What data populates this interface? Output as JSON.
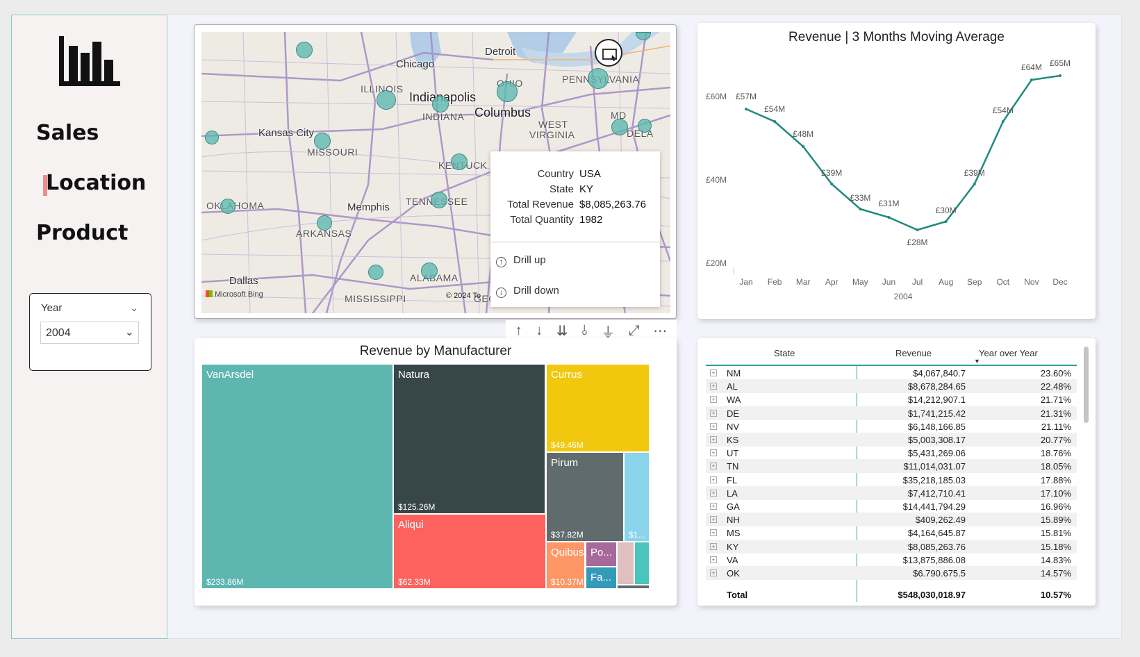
{
  "nav": {
    "sales": "Sales",
    "location": "Location",
    "product": "Product"
  },
  "slicer": {
    "label": "Year",
    "value": "2004"
  },
  "map": {
    "cities": [
      "Detroit",
      "Chicago",
      "Indianapolis",
      "Columbus",
      "Kansas City",
      "Memphis",
      "Dallas"
    ],
    "states": [
      "ILLINOIS",
      "INDIANA",
      "OHIO",
      "PENNSYLVANIA",
      "MISSOURI",
      "WEST",
      "VIRGINIA",
      "MD",
      "DELA",
      "KENTUCK",
      "TENNESSEE",
      "OKLAHOMA",
      "ARKANSAS",
      "ALABAMA",
      "MISSISSIPPI",
      "GEORGIA"
    ],
    "attribution": "Microsoft Bing",
    "copyright": "© 2024 To",
    "tooltip": {
      "country_label": "Country",
      "country": "USA",
      "state_label": "State",
      "state": "KY",
      "revenue_label": "Total Revenue",
      "revenue": "$8,085,263.76",
      "quantity_label": "Total Quantity",
      "quantity": "1982",
      "drill_up": "Drill up",
      "drill_down": "Drill down"
    }
  },
  "line_chart": {
    "title": "Revenue | 3 Months Moving Average",
    "x_axis_title": "2004",
    "color": "#1f8a80"
  },
  "chart_data": {
    "type": "line",
    "title": "Revenue | 3 Months Moving Average",
    "xlabel": "2004",
    "ylabel": "",
    "categories": [
      "Jan",
      "Feb",
      "Mar",
      "Apr",
      "May",
      "Jun",
      "Jul",
      "Aug",
      "Sep",
      "Oct",
      "Nov",
      "Dec"
    ],
    "values": [
      57,
      54,
      48,
      39,
      33,
      31,
      28,
      30,
      39,
      54,
      64,
      65
    ],
    "data_labels": [
      "£57M",
      "£54M",
      "£48M",
      "£39M",
      "£33M",
      "£31M",
      "£28M",
      "£30M",
      "£39M",
      "£54M",
      "£64M",
      "£65M"
    ],
    "y_ticks": [
      "£20M",
      "£40M",
      "£60M"
    ],
    "ylim": [
      20,
      60
    ]
  },
  "treemap": {
    "title": "Revenue by Manufacturer",
    "tiles": [
      {
        "name": "VanArsdel",
        "value": "$233.86M",
        "color": "#5db6b0"
      },
      {
        "name": "Natura",
        "value": "$125.26M",
        "color": "#374649"
      },
      {
        "name": "Currus",
        "value": "$49.46M",
        "color": "#f2c80f"
      },
      {
        "name": "Aliqui",
        "value": "$62.33M",
        "color": "#fd625e"
      },
      {
        "name": "Pirum",
        "value": "$37.82M",
        "color": "#5f6b6d"
      },
      {
        "name": "",
        "value": "$1...",
        "color": "#8ad4eb"
      },
      {
        "name": "Quibus",
        "value": "$10.37M",
        "color": "#fe9666"
      },
      {
        "name": "Po...",
        "value": "",
        "color": "#a66999"
      },
      {
        "name": "Fa...",
        "value": "",
        "color": "#3599b8"
      },
      {
        "name": "",
        "value": "",
        "color": "#dfbfbf"
      },
      {
        "name": "",
        "value": "",
        "color": "#4ac5bb"
      },
      {
        "name": "",
        "value": "",
        "color": "#5f6b6d"
      }
    ]
  },
  "table": {
    "headers": {
      "state": "State",
      "revenue": "Revenue",
      "yoy": "Year over Year"
    },
    "rows": [
      [
        "NM",
        "$4,067,840.7",
        "23.60%"
      ],
      [
        "AL",
        "$8,678,284.65",
        "22.48%"
      ],
      [
        "WA",
        "$14,212,907.1",
        "21.71%"
      ],
      [
        "DE",
        "$1,741,215.42",
        "21.31%"
      ],
      [
        "NV",
        "$6,148,166.85",
        "21.11%"
      ],
      [
        "KS",
        "$5,003,308.17",
        "20.77%"
      ],
      [
        "UT",
        "$5,431,269.06",
        "18.76%"
      ],
      [
        "TN",
        "$11,014,031.07",
        "18.05%"
      ],
      [
        "FL",
        "$35,218,185.03",
        "17.88%"
      ],
      [
        "LA",
        "$7,412,710.41",
        "17.10%"
      ],
      [
        "GA",
        "$14,441,794.29",
        "16.96%"
      ],
      [
        "NH",
        "$409,262.49",
        "15.89%"
      ],
      [
        "MS",
        "$4,164,645.87",
        "15.81%"
      ],
      [
        "KY",
        "$8,085,263.76",
        "15.18%"
      ],
      [
        "VA",
        "$13,875,886.08",
        "14.83%"
      ],
      [
        "OK",
        "$6.790.675.5",
        "14.57%"
      ]
    ],
    "total": {
      "label": "Total",
      "revenue": "$548,030,018.97",
      "yoy": "10.57%"
    }
  }
}
